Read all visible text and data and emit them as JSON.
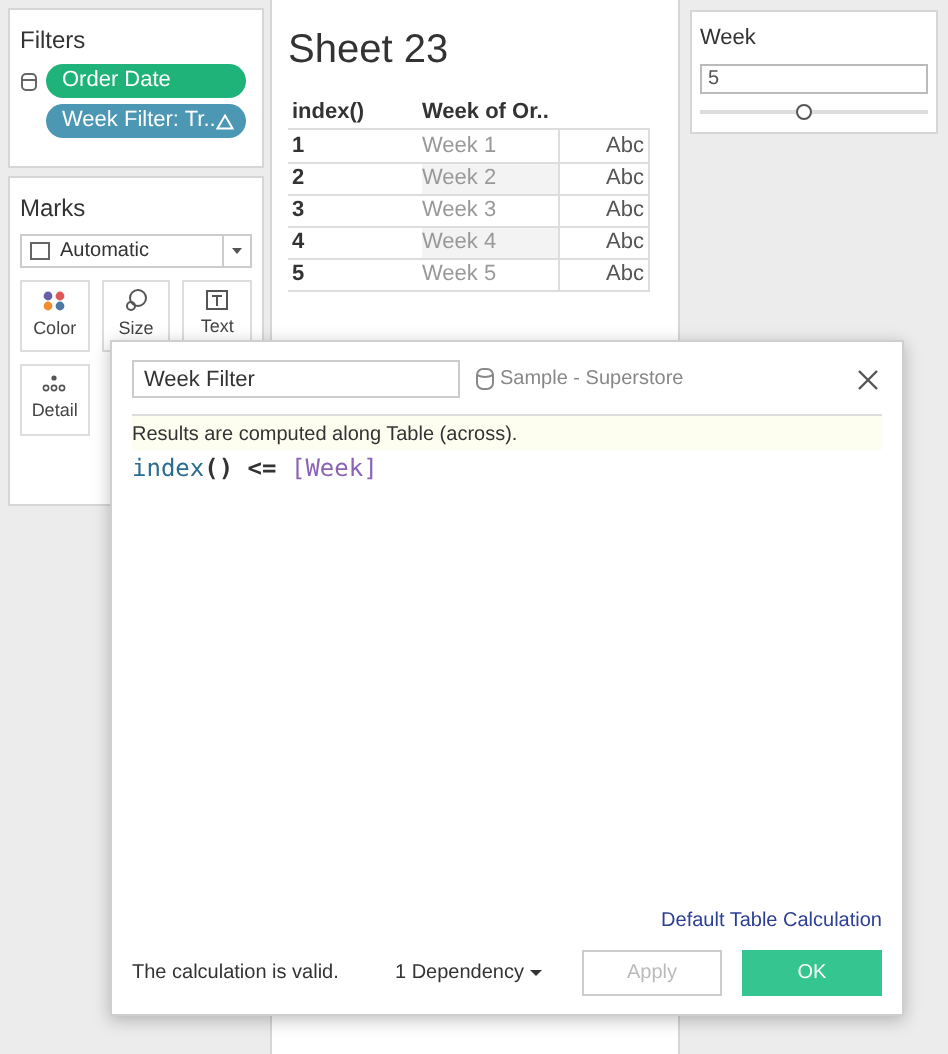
{
  "filters": {
    "title": "Filters",
    "pills": [
      {
        "label": "Order Date",
        "kind": "dimension",
        "color": "#1fb37a"
      },
      {
        "label": "Week Filter: Tr..",
        "kind": "table_calc",
        "color": "#4b97b4"
      }
    ]
  },
  "marks": {
    "title": "Marks",
    "mark_type": "Automatic",
    "cards": [
      {
        "label": "Color",
        "kind": "color"
      },
      {
        "label": "Size",
        "kind": "size"
      },
      {
        "label": "Text",
        "kind": "text"
      },
      {
        "label": "Detail",
        "kind": "detail"
      }
    ]
  },
  "sheet": {
    "title": "Sheet 23",
    "columns": [
      "index()",
      "Week of Or.."
    ],
    "rows": [
      [
        "1",
        "Week 1",
        "Abc"
      ],
      [
        "2",
        "Week 2",
        "Abc"
      ],
      [
        "3",
        "Week 3",
        "Abc"
      ],
      [
        "4",
        "Week 4",
        "Abc"
      ],
      [
        "5",
        "Week 5",
        "Abc"
      ]
    ]
  },
  "parameter": {
    "title": "Week",
    "value": "5",
    "level": 0.46
  },
  "dialog": {
    "name": "Week Filter",
    "data_source": "Sample - Superstore",
    "note": "Results are computed along Table (across).",
    "formula": [
      {
        "text": "index",
        "kind": "function"
      },
      {
        "text": "()",
        "kind": "operator"
      },
      {
        "text": " <= ",
        "kind": "operator"
      },
      {
        "text": "[Week]",
        "kind": "field"
      }
    ],
    "link": "Default Table Calculation",
    "status": "The calculation is valid.",
    "dependency": "1 Dependency",
    "buttons": [
      {
        "label": "Apply",
        "disabled": true,
        "primary": false
      },
      {
        "label": "OK",
        "disabled": false,
        "primary": true
      }
    ]
  }
}
